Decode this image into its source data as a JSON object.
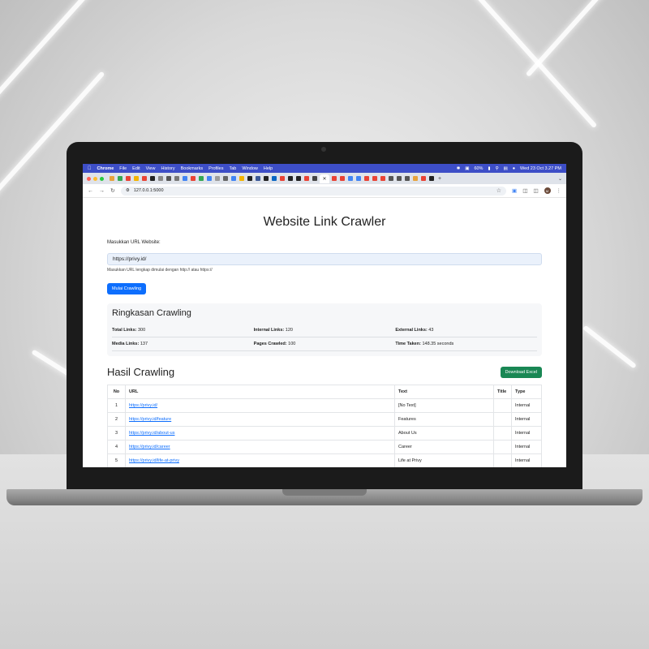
{
  "menubar": {
    "app_name": "Chrome",
    "menus": [
      "File",
      "Edit",
      "View",
      "History",
      "Bookmarks",
      "Profiles",
      "Tab",
      "Window",
      "Help"
    ],
    "battery": "60%",
    "datetime": "Wed 23 Oct  3.27 PM"
  },
  "browser": {
    "url": "127.0.0.1:5000",
    "profile_initial": "M",
    "tab_icon_colors": [
      "#e7a33e",
      "#34a853",
      "#e94335",
      "#f4b400",
      "#e94335",
      "#222222",
      "#888888",
      "#555555",
      "#777777",
      "#4285f4",
      "#e94335",
      "#34a853",
      "#4285f4",
      "#9c9c9c",
      "#666666",
      "#4285f4",
      "#f4b400",
      "#222222",
      "#3b5998",
      "#222222",
      "#0a66c2",
      "#e94335",
      "#222222",
      "#222222",
      "#e94335",
      "#444444"
    ],
    "tab_icon_colors_right": [
      "#e94335",
      "#e94335",
      "#4285f4",
      "#4285f4",
      "#e94335",
      "#e94335",
      "#e94335",
      "#555555",
      "#555555",
      "#555555",
      "#e7a33e",
      "#e94335",
      "#222222"
    ]
  },
  "page": {
    "title": "Website Link Crawler",
    "url_label": "Masukkan URL Website:",
    "url_value": "https://privy.id/",
    "help_text": "Masukkan URL lengkap dimulai dengan http:// atau https://",
    "submit_label": "Mulai Crawling"
  },
  "summary": {
    "heading": "Ringkasan Crawling",
    "stats": [
      {
        "label": "Total Links:",
        "value": "300"
      },
      {
        "label": "Internal Links:",
        "value": "120"
      },
      {
        "label": "External Links:",
        "value": "43"
      },
      {
        "label": "Media Links:",
        "value": "137"
      },
      {
        "label": "Pages Crawled:",
        "value": "100"
      },
      {
        "label": "Time Taken:",
        "value": "148.35 seconds"
      }
    ]
  },
  "results": {
    "heading": "Hasil Crawling",
    "download_label": "Download Excel",
    "columns": [
      "No",
      "URL",
      "Text",
      "Title",
      "Type"
    ],
    "rows": [
      {
        "no": "1",
        "url": "https://privy.id/",
        "text": "[No Text]",
        "title": "",
        "type": "Internal"
      },
      {
        "no": "2",
        "url": "https://privy.id/feature",
        "text": "Features",
        "title": "",
        "type": "Internal"
      },
      {
        "no": "3",
        "url": "https://privy.id/about-us",
        "text": "About Us",
        "title": "",
        "type": "Internal"
      },
      {
        "no": "4",
        "url": "https://privy.id/career",
        "text": "Career",
        "title": "",
        "type": "Internal"
      },
      {
        "no": "5",
        "url": "https://privy.id/life-at-privy",
        "text": "Life at Privy",
        "title": "",
        "type": "Internal"
      }
    ]
  },
  "colors": {
    "menubar": "#3d4ec7",
    "primary": "#0d6efd",
    "success": "#198754"
  }
}
